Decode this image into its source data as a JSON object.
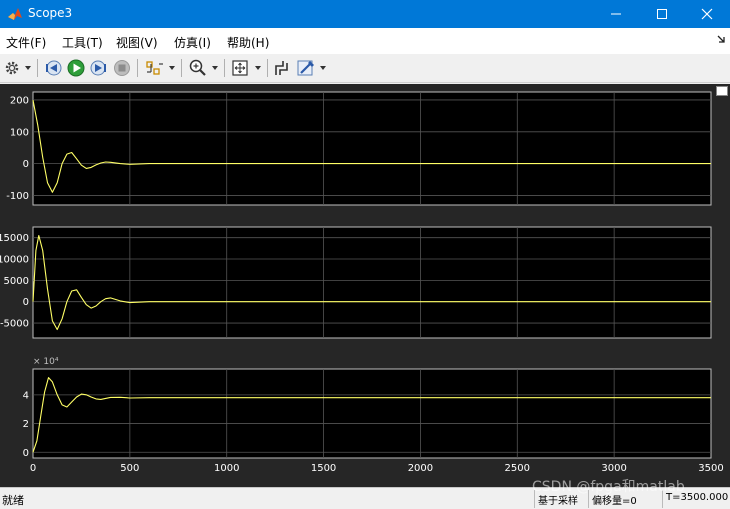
{
  "window": {
    "title": "Scope3",
    "accent_color": "#0078d7",
    "icon": "matlab-logo-icon"
  },
  "menu": {
    "items": [
      "文件(F)",
      "工具(T)",
      "视图(V)",
      "仿真(I)",
      "帮助(H)"
    ]
  },
  "toolbar": {
    "icons": [
      "gear-icon",
      "step-back-icon",
      "run-icon",
      "step-forward-icon",
      "stop-icon",
      "signal-trigger-icon",
      "zoom-icon",
      "fit-to-view-icon",
      "cursor-measure-icon",
      "highlight-edit-icon"
    ]
  },
  "status": {
    "ready": "就绪",
    "sample_based": "基于采样",
    "offset": "偏移量=0",
    "time": "T=3500.000"
  },
  "watermark": "CSDN @fpga和matlab",
  "colors": {
    "plot_background": "#000000",
    "figure_background": "#262626",
    "signal": "#ffff66",
    "grid": "#555555",
    "tick_text": "#ffffff"
  },
  "chart_data": [
    {
      "type": "line",
      "title": "",
      "x_ticks": [
        0,
        500,
        1000,
        1500,
        2000,
        2500,
        3000,
        3500
      ],
      "y_ticks": [
        -100,
        0,
        100,
        200
      ],
      "xlim": [
        0,
        3500
      ],
      "ylim": [
        -130,
        225
      ],
      "grid": true,
      "series": [
        {
          "x": [
            0,
            25,
            50,
            75,
            100,
            125,
            150,
            175,
            200,
            225,
            250,
            275,
            300,
            325,
            350,
            375,
            400,
            450,
            500,
            550,
            600,
            700,
            800,
            1000,
            1500,
            2000,
            2500,
            3000,
            3500
          ],
          "values": [
            200,
            120,
            20,
            -60,
            -90,
            -60,
            0,
            30,
            35,
            15,
            -5,
            -15,
            -12,
            -4,
            2,
            5,
            4,
            0,
            -2,
            -1,
            0,
            0,
            0,
            0,
            0,
            0,
            0,
            0,
            0
          ]
        }
      ]
    },
    {
      "type": "line",
      "title": "",
      "x_ticks": [
        0,
        500,
        1000,
        1500,
        2000,
        2500,
        3000,
        3500
      ],
      "y_ticks": [
        -5000,
        0,
        5000,
        10000,
        15000
      ],
      "xlim": [
        0,
        3500
      ],
      "ylim": [
        -8500,
        17500
      ],
      "grid": true,
      "series": [
        {
          "x": [
            0,
            15,
            30,
            50,
            75,
            100,
            125,
            150,
            175,
            200,
            225,
            250,
            275,
            300,
            325,
            350,
            375,
            400,
            450,
            500,
            600,
            700,
            800,
            1000,
            1500,
            2000,
            2500,
            3000,
            3500
          ],
          "values": [
            0,
            12000,
            15500,
            12000,
            3000,
            -4500,
            -6500,
            -4000,
            0,
            2500,
            2800,
            1000,
            -700,
            -1500,
            -1000,
            0,
            700,
            900,
            200,
            -200,
            0,
            0,
            0,
            0,
            0,
            0,
            0,
            0,
            0
          ]
        }
      ]
    },
    {
      "type": "line",
      "title": "",
      "exponent_label": "× 10⁴",
      "x_ticks": [
        0,
        500,
        1000,
        1500,
        2000,
        2500,
        3000,
        3500
      ],
      "x_tick_labels": [
        "0",
        "500",
        "1000",
        "1500",
        "2000",
        "2500",
        "3000",
        "3500"
      ],
      "y_ticks": [
        0,
        2,
        4
      ],
      "ylim": [
        -0.4,
        5.8
      ],
      "xlim": [
        0,
        3500
      ],
      "grid": true,
      "series": [
        {
          "x": [
            0,
            20,
            40,
            60,
            80,
            100,
            125,
            150,
            175,
            200,
            225,
            250,
            275,
            300,
            325,
            350,
            375,
            400,
            450,
            500,
            600,
            700,
            800,
            1000,
            1500,
            2000,
            2500,
            3000,
            3500
          ],
          "values": [
            0,
            0.8,
            2.5,
            4.2,
            5.2,
            4.9,
            4.0,
            3.3,
            3.15,
            3.5,
            3.85,
            4.05,
            4.0,
            3.85,
            3.72,
            3.68,
            3.75,
            3.82,
            3.83,
            3.78,
            3.8,
            3.8,
            3.8,
            3.8,
            3.8,
            3.8,
            3.8,
            3.8,
            3.8
          ]
        }
      ]
    }
  ]
}
